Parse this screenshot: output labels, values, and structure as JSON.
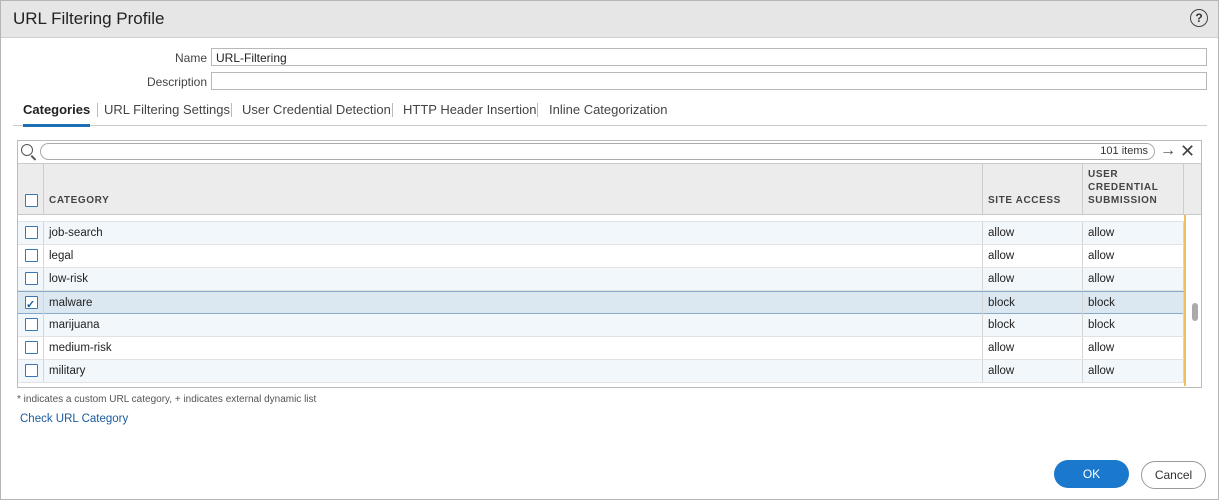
{
  "dialog": {
    "title": "URL Filtering Profile",
    "help_icon": "?"
  },
  "form": {
    "name_label": "Name",
    "name_value": "URL-Filtering",
    "description_label": "Description",
    "description_value": ""
  },
  "tabs": [
    {
      "label": "Categories",
      "active": true
    },
    {
      "label": "URL Filtering Settings",
      "active": false
    },
    {
      "label": "User Credential Detection",
      "active": false
    },
    {
      "label": "HTTP Header Insertion",
      "active": false
    },
    {
      "label": "Inline Categorization",
      "active": false
    }
  ],
  "grid": {
    "item_count": "101 items",
    "columns": {
      "category": "CATEGORY",
      "site_access": "SITE ACCESS",
      "user_credential": [
        "USER",
        "CREDENTIAL",
        "SUBMISSION"
      ]
    },
    "rows": [
      {
        "category": "job-search",
        "site_access": "allow",
        "user_credential": "allow",
        "checked": false
      },
      {
        "category": "legal",
        "site_access": "allow",
        "user_credential": "allow",
        "checked": false
      },
      {
        "category": "low-risk",
        "site_access": "allow",
        "user_credential": "allow",
        "checked": false
      },
      {
        "category": "malware",
        "site_access": "block",
        "user_credential": "block",
        "checked": true
      },
      {
        "category": "marijuana",
        "site_access": "block",
        "user_credential": "block",
        "checked": false
      },
      {
        "category": "medium-risk",
        "site_access": "allow",
        "user_credential": "allow",
        "checked": false
      },
      {
        "category": "military",
        "site_access": "allow",
        "user_credential": "allow",
        "checked": false
      }
    ]
  },
  "footnote": "* indicates a custom URL category, + indicates external dynamic list",
  "check_link": "Check URL Category",
  "buttons": {
    "ok": "OK",
    "cancel": "Cancel"
  },
  "colors": {
    "accent": "#1a79cc",
    "selected_row": "#dbe7f1",
    "alt_row": "#f2f7fb"
  }
}
